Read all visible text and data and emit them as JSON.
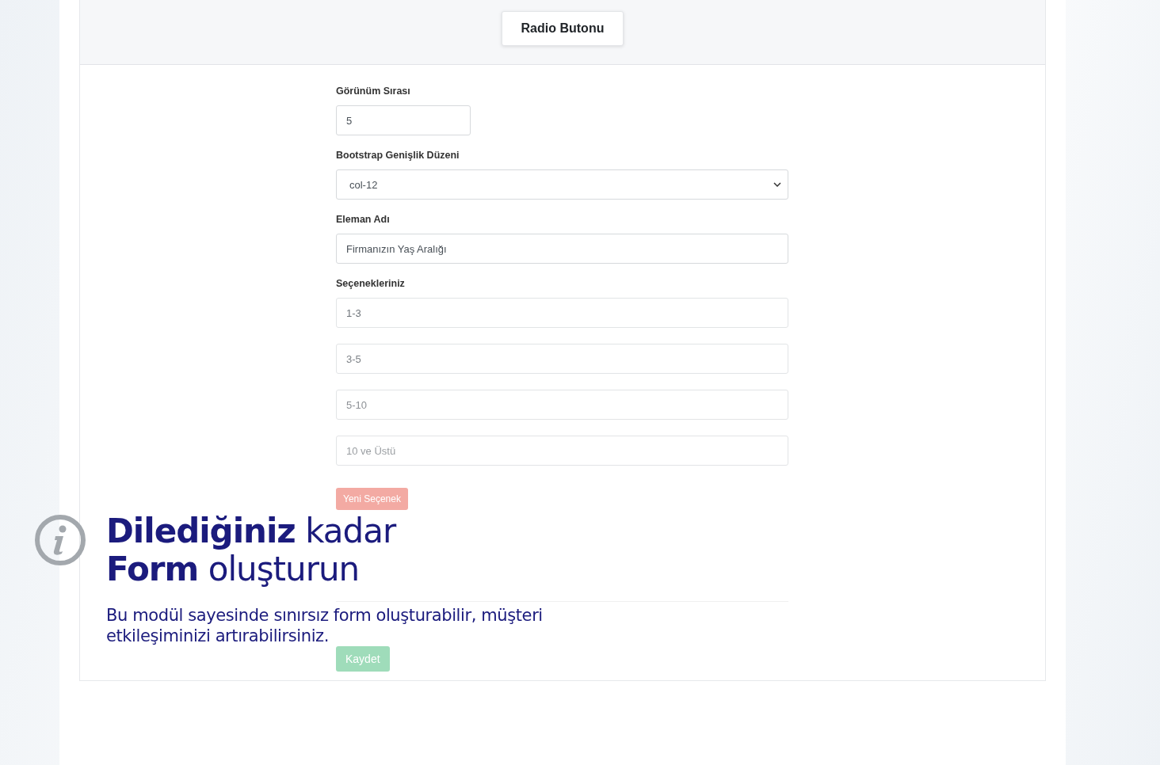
{
  "header": {
    "tab": "Radio Butonu"
  },
  "form": {
    "order": {
      "label": "Görünüm Sırası",
      "value": "5"
    },
    "width": {
      "label": "Bootstrap Genişlik Düzeni",
      "value": "col-12"
    },
    "name": {
      "label": "Eleman Adı",
      "value": "Firmanızın Yaş Aralığı"
    },
    "options_label": "Seçenekleriniz",
    "options": [
      {
        "value": "1-3"
      },
      {
        "value": "3-5"
      },
      {
        "value": "5-10"
      },
      {
        "value": "10 ve Üstü"
      }
    ],
    "add_button": "Yeni Seçenek",
    "save_button": "Kaydet"
  },
  "promo": {
    "headline": [
      "**Dilediğiniz** kadar",
      "**Form** oluşturun"
    ],
    "description": "Bu modül sayesinde sınırsız form oluşturabilir, müşteri etkileşiminizi artırabilirsiniz."
  }
}
